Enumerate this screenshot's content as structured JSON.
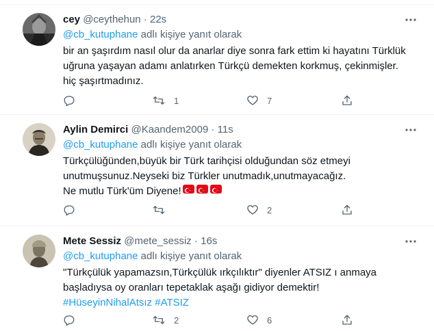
{
  "tweets": [
    {
      "name": "cey",
      "handle": "@ceythehun",
      "time": "22s",
      "reply_prefix": "@cb_kutuphane",
      "reply_suffix": " adlı kişiye yanıt olarak",
      "lines": [
        "bir an şaşırdım nasıl olur da anarlar diye sonra fark ettim ki hayatını Türklük",
        "uğruna yaşayan adamı anlatırken Türkçü demekten korkmuş, çekinmişler.",
        "hiç şaşırtmadınız."
      ],
      "retweets": "1",
      "likes": "7"
    },
    {
      "name": "Aylin Demirci",
      "handle": "@Kaandem2009",
      "time": "11s",
      "reply_prefix": "@cb_kutuphane",
      "reply_suffix": " adlı kişiye yanıt olarak",
      "lines": [
        "Türkçülüğünden,büyük bir Türk tarihçisi olduğundan söz etmeyi",
        "unutmuşsunuz.Neyseki biz Türkler unutmadık,unutmayacağız.",
        "Ne mutlu Türk'üm Diyene!"
      ],
      "retweets": "",
      "likes": "2"
    },
    {
      "name": "Mete Sessiz",
      "handle": "@mete_sessiz",
      "time": "16s",
      "reply_prefix": "@cb_kutuphane",
      "reply_suffix": " adlı kişiye yanıt olarak",
      "lines": [
        "\"Türkçülük yapamazsın,Türkçülük ırkçılıktır\" diyenler ATSIZ ı anmaya",
        "başladıysa oy oranları tepetaklak aşağı gidiyor demektir!"
      ],
      "hashtags": "#HüseyinNihalAtsız #ATSIZ",
      "retweets": "2",
      "likes": "6"
    }
  ],
  "separator": "·",
  "icons": [
    "more-icon",
    "reply-icon",
    "retweet-icon",
    "like-icon",
    "share-icon",
    "turkish-flag-icon"
  ],
  "colors": {
    "link": "#1d9bf0",
    "secondary": "#536471",
    "text": "#0f1419",
    "flag": "#e30a17"
  }
}
